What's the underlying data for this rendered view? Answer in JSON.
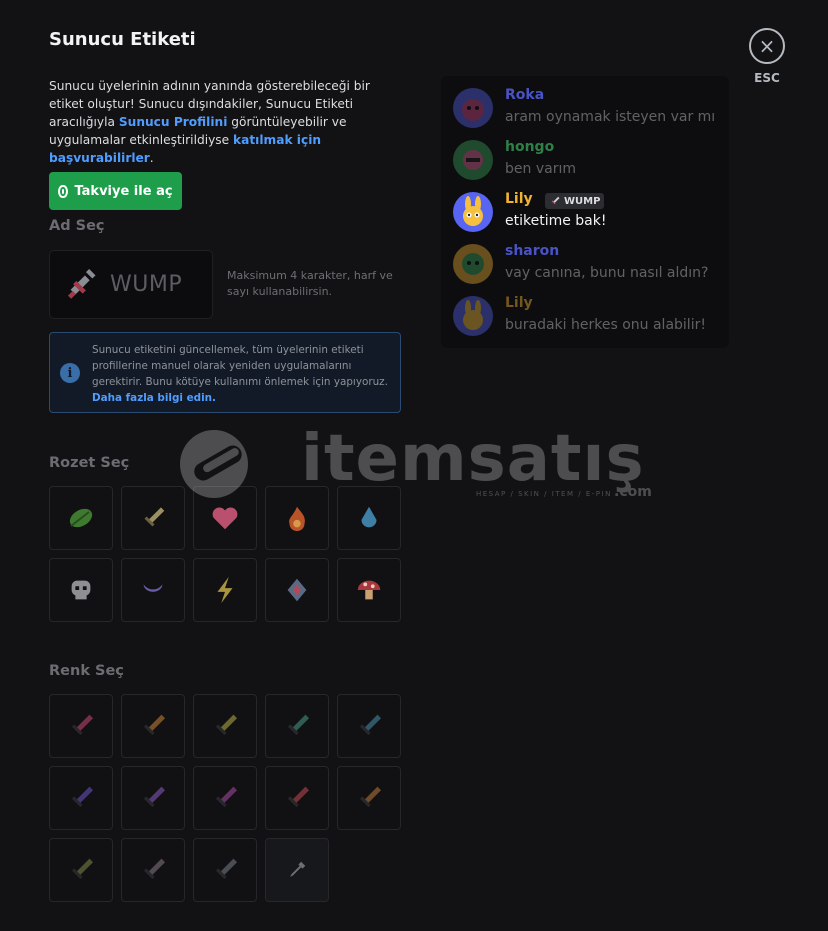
{
  "modal": {
    "title": "Sunucu Etiketi",
    "esc_label": "ESC",
    "close_glyph": "×",
    "desc_part1": "Sunucu üyelerinin adının yanında gösterebileceği bir etiket oluştur! Sunucu dışındakiler, Sunucu Etiketi aracılığıyla ",
    "desc_link1": "Sunucu Profilini",
    "desc_part2": " görüntüleyebilir ve uygulamalar etkinleştirildiyse ",
    "desc_link2": "katılmak için başvurabilirler",
    "desc_part3": ".",
    "unlock_button": "Takviye ile aç"
  },
  "name_section": {
    "label": "Ad Seç",
    "value": "WUMP",
    "hint": "Maksimum 4 karakter, harf ve sayı kullanabilirsin."
  },
  "info": {
    "icon_glyph": "i",
    "text": "Sunucu etiketini güncellemek, tüm üyelerinin etiketi profillerine manuel olarak yeniden uygulamalarını gerektirir. Bunu kötüye kullanımı önlemek için yapıyoruz. ",
    "link": "Daha fazla bilgi edin."
  },
  "badge_section": {
    "label": "Rozet Seç",
    "badges": [
      {
        "icon": "leaf-icon"
      },
      {
        "icon": "sword-icon"
      },
      {
        "icon": "heart-icon"
      },
      {
        "icon": "flame-icon"
      },
      {
        "icon": "water-drop-icon"
      },
      {
        "icon": "skull-icon"
      },
      {
        "icon": "moon-icon"
      },
      {
        "icon": "lightning-icon"
      },
      {
        "icon": "crystal-icon"
      },
      {
        "icon": "mushroom-icon"
      }
    ]
  },
  "color_section": {
    "label": "Renk Seç",
    "colors": [
      "#c84a73",
      "#c9843a",
      "#b7b04b",
      "#4a9a88",
      "#4c8fa8",
      "#6f55c4",
      "#8a5ec0",
      "#a64ea4",
      "#c24c55",
      "#b97b3f",
      "#7b8a4a",
      "#8a7a84",
      "#7a7f88"
    ],
    "custom_picker_icon": "eyedropper-icon"
  },
  "chat": {
    "messages": [
      {
        "name": "Roka",
        "text": "aram oynamak isteyen var mı",
        "name_color": "#5865f2",
        "dim": true
      },
      {
        "name": "hongo",
        "text": "ben varım",
        "name_color": "#3ba55c",
        "dim": true
      },
      {
        "name": "Lily",
        "text": "etiketime bak!",
        "name_color": "#f0b232",
        "dim": false,
        "tag": "WUMP"
      },
      {
        "name": "sharon",
        "text": "vay canına, bunu nasıl aldın?",
        "name_color": "#5865f2",
        "dim": true
      },
      {
        "name": "Lily",
        "text": "buradaki herkes onu alabilir!",
        "name_color": "#f0b232",
        "dim": true
      }
    ]
  },
  "watermark": {
    "text": "itemsatış",
    "subtext": "HESAP / SKIN / ITEM / E-PIN",
    "domain": ".com"
  }
}
